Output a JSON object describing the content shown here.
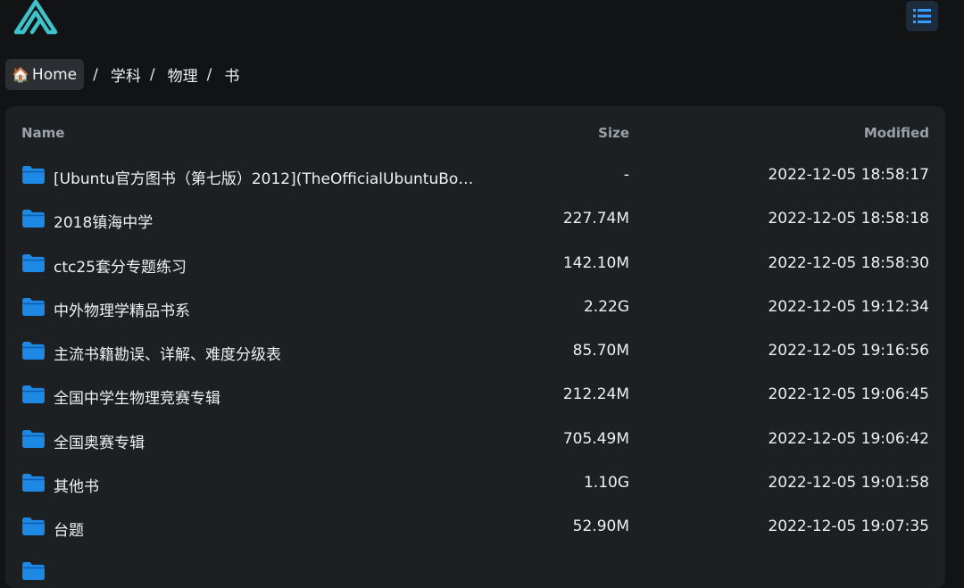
{
  "header": {
    "logo_icon": "alist-logo-icon",
    "view_toggle_icon": "list-view-icon"
  },
  "breadcrumb": {
    "home_icon": "🏠",
    "home_label": "Home",
    "separator": "/",
    "items": [
      "学科",
      "物理",
      "书"
    ]
  },
  "table": {
    "columns": {
      "name": "Name",
      "size": "Size",
      "modified": "Modified"
    },
    "rows": [
      {
        "name": "[Ubuntu官方图书（第七版）2012](TheOfficialUbuntuBook...",
        "size": "-",
        "modified": "2022-12-05 18:58:17"
      },
      {
        "name": "2018镇海中学",
        "size": "227.74M",
        "modified": "2022-12-05 18:58:18"
      },
      {
        "name": "ctc25套分专题练习",
        "size": "142.10M",
        "modified": "2022-12-05 18:58:30"
      },
      {
        "name": "中外物理学精品书系",
        "size": "2.22G",
        "modified": "2022-12-05 19:12:34"
      },
      {
        "name": "主流书籍勘误、详解、难度分级表",
        "size": "85.70M",
        "modified": "2022-12-05 19:16:56"
      },
      {
        "name": "全国中学生物理竞赛专辑",
        "size": "212.24M",
        "modified": "2022-12-05 19:06:45"
      },
      {
        "name": "全国奥赛专辑",
        "size": "705.49M",
        "modified": "2022-12-05 19:06:42"
      },
      {
        "name": "其他书",
        "size": "1.10G",
        "modified": "2022-12-05 19:01:58"
      },
      {
        "name": "台题",
        "size": "52.90M",
        "modified": "2022-12-05 19:07:35"
      },
      {
        "name": "",
        "size": "",
        "modified": ""
      }
    ]
  },
  "colors": {
    "background": "#111315",
    "panel": "#1d2023",
    "folder_icon": "#1e88e5",
    "accent": "#3b9cff",
    "logo": "#3fc1c9"
  }
}
